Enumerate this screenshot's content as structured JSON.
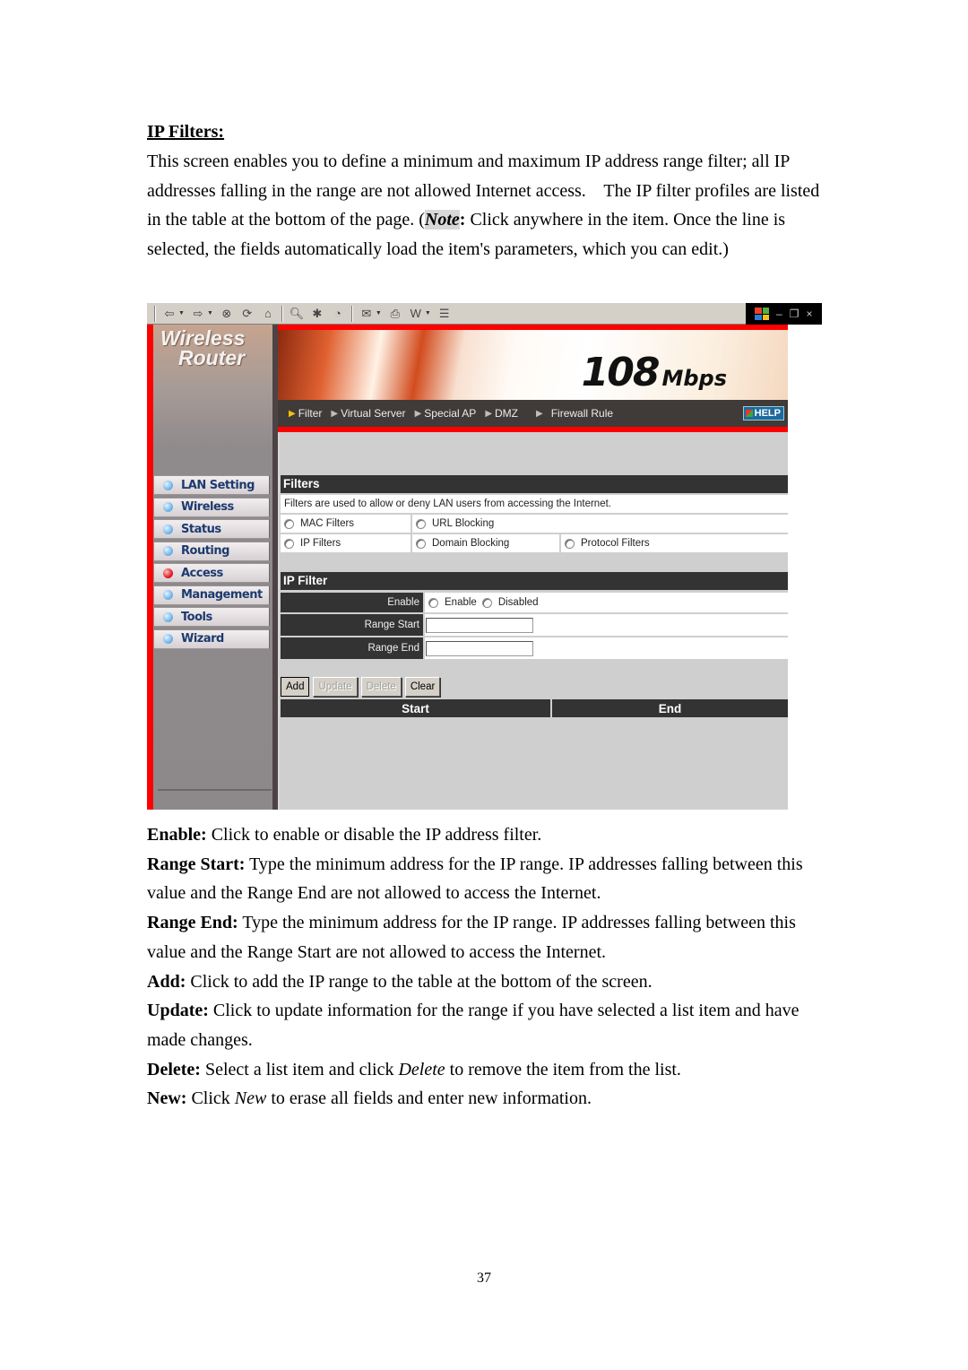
{
  "document": {
    "section_title": "IP Filters:",
    "intro_before_note": "This screen enables you to define a minimum and maximum IP address range filter; all IP addresses falling in the range are not allowed Internet access.    The IP filter profiles are listed in the table at the bottom of the page. (",
    "note_label": "Note",
    "note_colon": ":",
    "intro_after_note": " Click anywhere in the item. Once the line is selected, the fields automatically load the item's parameters, which you can edit.)",
    "descriptions": [
      {
        "term": "Enable:",
        "text": " Click to enable or disable the IP address filter."
      },
      {
        "term": "Range Start:",
        "text": " Type the minimum address for the IP range. IP addresses falling between this value and the Range End are not allowed to access the Internet."
      },
      {
        "term": "Range End:",
        "text": " Type the minimum address for the IP range. IP addresses falling between this value and the Range Start are not allowed to access the Internet."
      },
      {
        "term": "Add:",
        "text": " Click to add the IP range to the table at the bottom of the screen."
      },
      {
        "term": "Update:",
        "text": " Click to update information for the range if you have selected a list item and have made changes."
      },
      {
        "term": "Delete:",
        "text_before": " Select a list item and click ",
        "emph": "Delete",
        "text_after": " to remove the item from the list."
      },
      {
        "term": "New:",
        "text_before": " Click ",
        "emph": "New",
        "text_after": " to erase all fields and enter new information."
      }
    ],
    "page_number": "37"
  },
  "browser": {
    "toolbar_icons": [
      "back-icon",
      "forward-icon",
      "stop-icon",
      "refresh-icon",
      "home-icon",
      "search-icon",
      "favorites-icon",
      "history-icon",
      "mail-icon",
      "print-icon",
      "edit-icon",
      "discuss-icon"
    ],
    "window_controls": {
      "minimize": "–",
      "restore": "҂",
      "close": "×"
    }
  },
  "router": {
    "brand_line1": "Wireless",
    "brand_line2": "Router",
    "banner_big": "108",
    "banner_small": "Mbps",
    "nav": [
      {
        "label": "Filter",
        "active": true
      },
      {
        "label": "Virtual Server",
        "active": false
      },
      {
        "label": "Special AP",
        "active": false
      },
      {
        "label": "DMZ",
        "active": false
      },
      {
        "label": "Firewall Rule",
        "active": false
      }
    ],
    "help_label": "HELP",
    "menu": [
      {
        "label": "LAN Setting",
        "active": false
      },
      {
        "label": "Wireless",
        "active": false
      },
      {
        "label": "Status",
        "active": false
      },
      {
        "label": "Routing",
        "active": false
      },
      {
        "label": "Access",
        "active": true
      },
      {
        "label": "Management",
        "active": false
      },
      {
        "label": "Tools",
        "active": false
      },
      {
        "label": "Wizard",
        "active": false
      }
    ],
    "filters": {
      "title": "Filters",
      "description": "Filters are used to allow or deny LAN users from accessing the Internet.",
      "options_row1": [
        "MAC Filters",
        "URL Blocking"
      ],
      "options_row2": [
        "IP Filters",
        "Domain Blocking",
        "Protocol Filters"
      ]
    },
    "ip_filter": {
      "title": "IP Filter",
      "enable_label": "Enable",
      "enable_options": [
        "Enable",
        "Disabled"
      ],
      "range_start_label": "Range Start",
      "range_start_value": "",
      "range_end_label": "Range End",
      "range_end_value": ""
    },
    "buttons": {
      "add": "Add",
      "update": "Update",
      "delete": "Delete",
      "clear": "Clear"
    },
    "list_columns": [
      "Start",
      "End"
    ]
  },
  "colors": {
    "router_red": "#ff0000",
    "header_dark": "#333333",
    "panel_gray": "#cfcfcf",
    "menu_text": "#1d3a6e"
  }
}
